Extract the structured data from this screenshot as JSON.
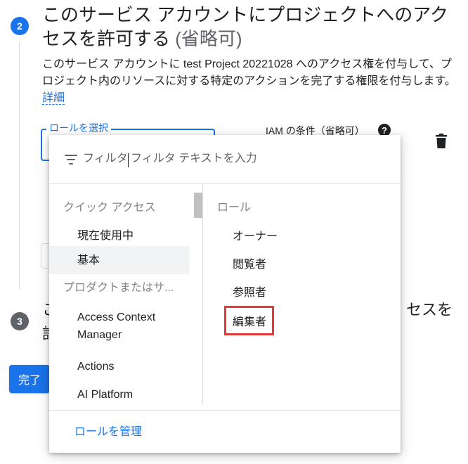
{
  "step2": {
    "number": "2",
    "title": "このサービス アカウントにプロジェクトへのアクセスを許可する",
    "optional": "(省略可)",
    "description": "このサービス アカウントに test Project 20221028 へのアクセス権を付与して、プロジェクト内のリソースに対する特定のアクションを完了する権限を付与します。",
    "details_link": "詳細"
  },
  "role_field": {
    "label": "ロールを選択"
  },
  "iam_condition": {
    "label": "IAM の条件（省略可）",
    "help_icon": "help-icon"
  },
  "delete_icon": "trash-icon",
  "step3": {
    "number": "3",
    "title_left": "こ",
    "title_left_line2": "許",
    "title_right": "セスを"
  },
  "done_button": "完了",
  "popup": {
    "filter_label": "フィルタ",
    "filter_placeholder": "フィルタ テキストを入力",
    "left_sections": {
      "quick_access_header": "クイック アクセス",
      "quick_access_items": [
        "現在使用中",
        "基本"
      ],
      "selected_item": "基本",
      "products_header": "プロダクトまたはサ...",
      "product_items": [
        "Access Context Manager",
        "Actions",
        "AI Platform"
      ]
    },
    "right_section": {
      "header": "ロール",
      "roles": [
        "オーナー",
        "閲覧者",
        "参照者",
        "編集者"
      ],
      "highlighted_role": "編集者"
    },
    "manage_roles": "ロールを管理"
  },
  "colors": {
    "accent": "#1a73e8",
    "highlight_border": "#e53935",
    "step_inactive": "#5f6368"
  }
}
